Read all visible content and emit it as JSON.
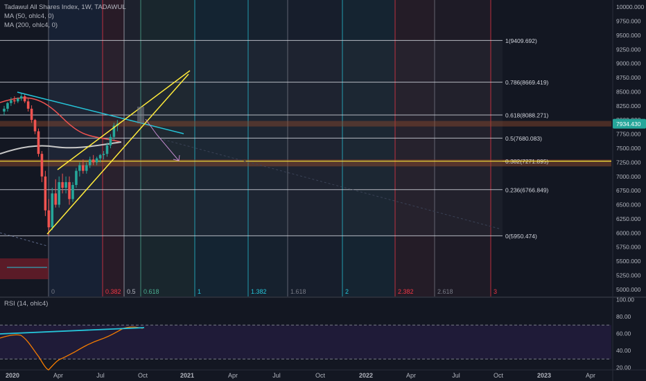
{
  "legend": {
    "symbol": "Tadawul All Shares Index, 1W, TADAWUL",
    "ma50": "MA (50, ohlc4, 0)",
    "ma200": "MA (200, ohlc4, 0)",
    "rsi": "RSI (14, ohlc4)"
  },
  "price_badge": "7934.430",
  "price_axis": {
    "min": 4875,
    "max": 10125,
    "ticks": [
      "10000.000",
      "9750.000",
      "9500.000",
      "9250.000",
      "9000.000",
      "8750.000",
      "8500.000",
      "8250.000",
      "8000.000",
      "7750.000",
      "7500.000",
      "7250.000",
      "7000.000",
      "6750.000",
      "6500.000",
      "6250.000",
      "6000.000",
      "5750.000",
      "5500.000",
      "5250.000",
      "5000.000"
    ],
    "tick_values": [
      10000,
      9750,
      9500,
      9250,
      9000,
      8750,
      8500,
      8250,
      8000,
      7750,
      7500,
      7250,
      7000,
      6750,
      6500,
      6250,
      6000,
      5750,
      5500,
      5250,
      5000
    ]
  },
  "rsi_axis": {
    "min": 18,
    "max": 102,
    "ticks": [
      "100.00",
      "80.00",
      "60.00",
      "40.00",
      "20.00"
    ],
    "tick_values": [
      100,
      80,
      60,
      40,
      20
    ]
  },
  "time_axis": [
    "2020",
    "Apr",
    "Jul",
    "Oct",
    "2021",
    "Apr",
    "Jul",
    "Oct",
    "2022",
    "Apr",
    "Jul",
    "Oct",
    "2023",
    "Apr"
  ],
  "fib_retracement": [
    {
      "label": "1(9409.692)",
      "value": 9409.692
    },
    {
      "label": "0.786(8669.419)",
      "value": 8669.419
    },
    {
      "label": "0.618(8088.271)",
      "value": 8088.271
    },
    {
      "label": "0.5(7680.083)",
      "value": 7680.083
    },
    {
      "label": "0.382(7271.895)",
      "value": 7271.895
    },
    {
      "label": "0.236(6766.849)",
      "value": 6766.849
    },
    {
      "label": "0(5950.474)",
      "value": 5950.474
    }
  ],
  "fib_time": [
    {
      "label": "0",
      "color": "#787b86"
    },
    {
      "label": "0.382",
      "color": "#f23645"
    },
    {
      "label": "0.5",
      "color": "#b2b5be"
    },
    {
      "label": "0.618",
      "color": "#4caf92"
    },
    {
      "label": "1",
      "color": "#26c6da"
    },
    {
      "label": "1.382",
      "color": "#26c6da"
    },
    {
      "label": "1.618",
      "color": "#787b86"
    },
    {
      "label": "2",
      "color": "#26c6da"
    },
    {
      "label": "2.382",
      "color": "#f23645"
    },
    {
      "label": "2.618",
      "color": "#787b86"
    },
    {
      "label": "3",
      "color": "#f23645"
    }
  ],
  "colors": {
    "background": "#131722",
    "up": "#26a69a",
    "down": "#ef5350",
    "ma50": "#ef5350",
    "ma200": "#b2b5be",
    "trendline": "#26c6da",
    "wedge": "#ffeb3b",
    "rsi": "#f57c00",
    "price_badge": "#26a69a"
  },
  "candles": [
    [
      8150,
      8250,
      8080,
      8200
    ],
    [
      8200,
      8320,
      8150,
      8300
    ],
    [
      8300,
      8400,
      8250,
      8350
    ],
    [
      8350,
      8420,
      8280,
      8330
    ],
    [
      8330,
      8400,
      8300,
      8380
    ],
    [
      8380,
      8470,
      8340,
      8420
    ],
    [
      8420,
      8460,
      8300,
      8330
    ],
    [
      8330,
      8380,
      8150,
      8200
    ],
    [
      8200,
      8260,
      7950,
      8000
    ],
    [
      8000,
      8020,
      7750,
      7800
    ],
    [
      7800,
      7850,
      7350,
      7400
    ],
    [
      7400,
      7450,
      6900,
      7000
    ],
    [
      7000,
      7100,
      6300,
      6400
    ],
    [
      6400,
      6600,
      5950,
      6100
    ],
    [
      6100,
      6800,
      6050,
      6700
    ],
    [
      6700,
      6950,
      6450,
      6500
    ],
    [
      6500,
      7000,
      6450,
      6900
    ],
    [
      6900,
      7050,
      6700,
      6800
    ],
    [
      6800,
      7000,
      6700,
      6900
    ],
    [
      6900,
      7000,
      6500,
      6600
    ],
    [
      6600,
      6900,
      6550,
      6850
    ],
    [
      6850,
      7150,
      6800,
      7100
    ],
    [
      7100,
      7250,
      7000,
      7200
    ],
    [
      7200,
      7300,
      7050,
      7100
    ],
    [
      7100,
      7250,
      7050,
      7200
    ],
    [
      7200,
      7350,
      7150,
      7300
    ],
    [
      7300,
      7380,
      7200,
      7250
    ],
    [
      7250,
      7350,
      7200,
      7320
    ],
    [
      7320,
      7400,
      7250,
      7380
    ],
    [
      7380,
      7450,
      7300,
      7400
    ],
    [
      7400,
      7600,
      7350,
      7550
    ],
    [
      7550,
      7750,
      7500,
      7700
    ],
    [
      7700,
      7950,
      7650,
      7900
    ],
    [
      7900,
      8000,
      7800,
      7934
    ]
  ]
}
